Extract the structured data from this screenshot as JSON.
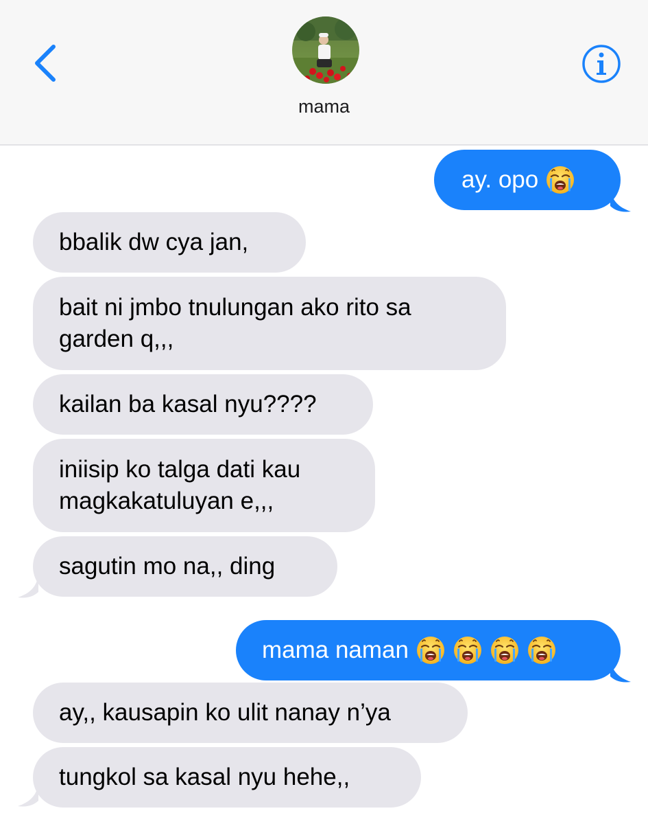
{
  "header": {
    "contact_name": "mama"
  },
  "icons": {
    "back": "chevron-left-icon",
    "info": "info-icon",
    "emoji": "loudly-crying-face"
  },
  "colors": {
    "accent": "#1a82fb",
    "received_bubble": "#e6e5eb",
    "header_bg": "#f7f7f7"
  },
  "messages": [
    {
      "from": "me",
      "text": "ay. opo",
      "emoji_count": 1
    },
    {
      "from": "them",
      "text": "bbalik dw cya jan,"
    },
    {
      "from": "them",
      "text": "bait ni jmbo tnulungan ako rito sa garden q,,,"
    },
    {
      "from": "them",
      "text": "kailan ba kasal nyu????"
    },
    {
      "from": "them",
      "text": "iniisip ko talga dati kau magkakatuluyan e,,,"
    },
    {
      "from": "them",
      "text": "sagutin mo na,, ding"
    },
    {
      "from": "me",
      "text": "mama naman",
      "emoji_count": 4
    },
    {
      "from": "them",
      "text": "ay,, kausapin ko ulit nanay n’ya"
    },
    {
      "from": "them",
      "text": "tungkol sa kasal nyu hehe,,"
    }
  ]
}
